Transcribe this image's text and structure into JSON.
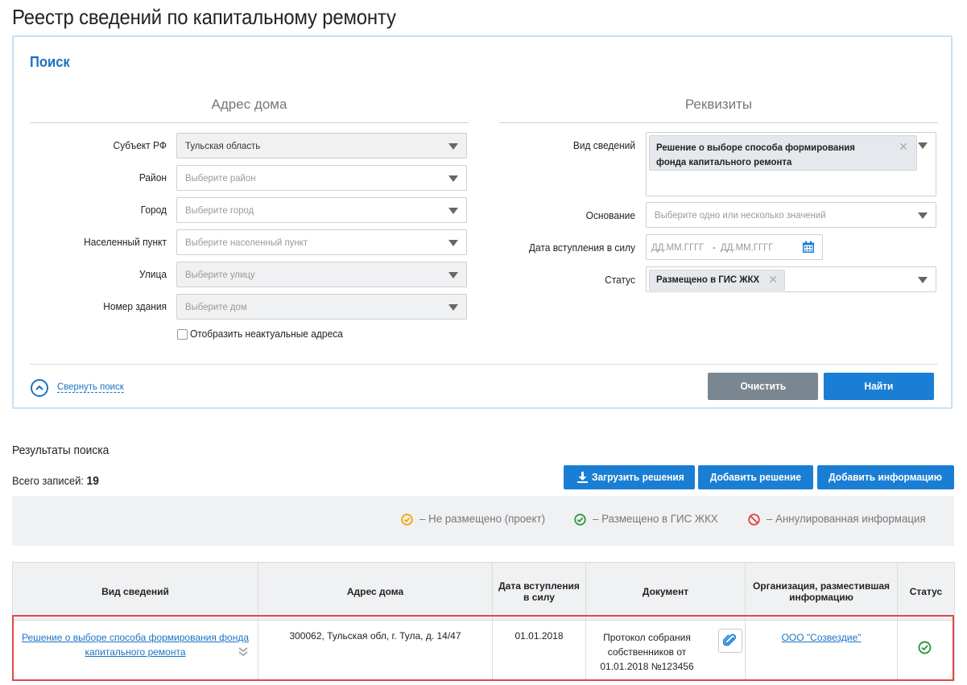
{
  "page": {
    "title": "Реестр сведений по капитальному ремонту"
  },
  "search": {
    "title": "Поиск",
    "address_section": "Адрес дома",
    "requisites_section": "Реквизиты",
    "fields": {
      "subject": {
        "label": "Субъект РФ",
        "value": "Тульская область"
      },
      "district": {
        "label": "Район",
        "placeholder": "Выберите район"
      },
      "city": {
        "label": "Город",
        "placeholder": "Выберите город"
      },
      "locality": {
        "label": "Населенный пункт",
        "placeholder": "Выберите населенный пункт"
      },
      "street": {
        "label": "Улица",
        "placeholder": "Выберите улицу"
      },
      "building": {
        "label": "Номер здания",
        "placeholder": "Выберите дом"
      },
      "show_inactive": "Отобразить неактуальные адреса",
      "info_type": {
        "label": "Вид сведений",
        "tag": "Решение о выборе способа формирования фонда капитального ремонта"
      },
      "basis": {
        "label": "Основание",
        "placeholder": "Выберите одно или несколько значений"
      },
      "effective_date": {
        "label": "Дата вступления в силу",
        "from_placeholder": "ДД.ММ.ГГГГ",
        "separator": "-",
        "to_placeholder": "ДД.ММ.ГГГГ"
      },
      "status": {
        "label": "Статус",
        "tag": "Размещено в ГИС ЖКХ"
      }
    },
    "collapse_label": "Свернуть поиск",
    "clear_label": "Очистить",
    "find_label": "Найти"
  },
  "results": {
    "title": "Результаты поиска",
    "total_label": "Всего записей:",
    "total_count": "19",
    "buttons": {
      "upload": "Загрузить решения",
      "add_decision": "Добавить решение",
      "add_info": "Добавить информацию"
    },
    "legend": [
      {
        "label": "–  Не размещено (проект)",
        "color": "#f0a400",
        "icon": "check-circle-icon"
      },
      {
        "label": "–  Размещено в ГИС ЖКХ",
        "color": "#2a9a3a",
        "icon": "check-circle-icon"
      },
      {
        "label": "–  Аннулированная информация",
        "color": "#e04848",
        "icon": "cancel-circle-icon"
      }
    ],
    "columns": [
      "Вид сведений",
      "Адрес дома",
      "Дата вступления в силу",
      "Документ",
      "Организация, разместившая информацию",
      "Статус"
    ],
    "rows": [
      {
        "info_type": "Решение о выборе способа формирования фонда капитального ремонта",
        "address": "300062, Тульская обл, г. Тула, д. 14/47",
        "date": "01.01.2018",
        "document": "Протокол собрания собственников от 01.01.2018 №123456",
        "organization": "ООО \"Созвездие\"",
        "status": "Размещено в ГИС ЖКХ"
      }
    ]
  }
}
